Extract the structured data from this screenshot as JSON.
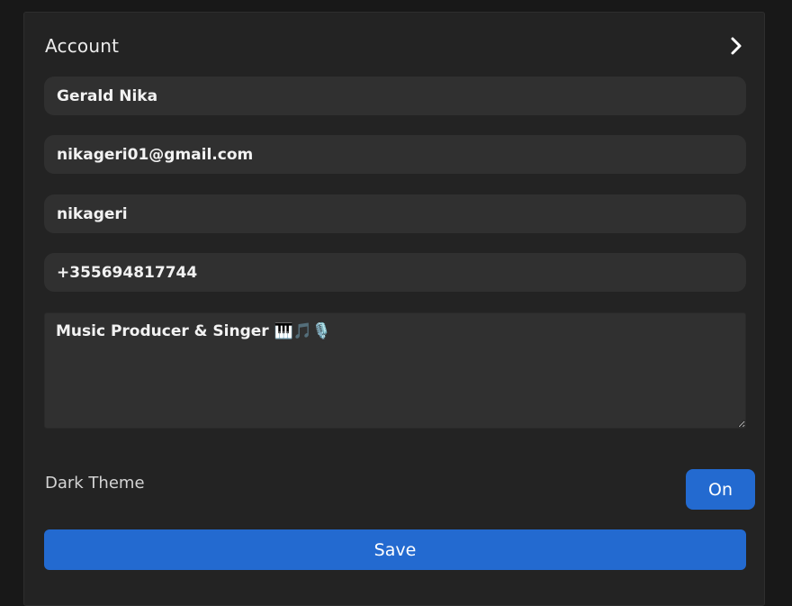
{
  "account": {
    "title": "Account",
    "chevron_icon": "chevron-right-icon"
  },
  "form": {
    "full_name": "Gerald Nika",
    "email": "nikageri01@gmail.com",
    "username": "nikageri",
    "phone": "+355694817744",
    "bio": "Music Producer & Singer 🎹🎵🎙️"
  },
  "settings": {
    "dark_theme_label": "Dark Theme",
    "dark_theme_state": "On"
  },
  "actions": {
    "save_label": "Save"
  },
  "colors": {
    "page_bg": "#181818",
    "panel_bg": "#232323",
    "field_bg": "#303030",
    "accent": "#236ad0",
    "text": "#f2f2f2"
  }
}
